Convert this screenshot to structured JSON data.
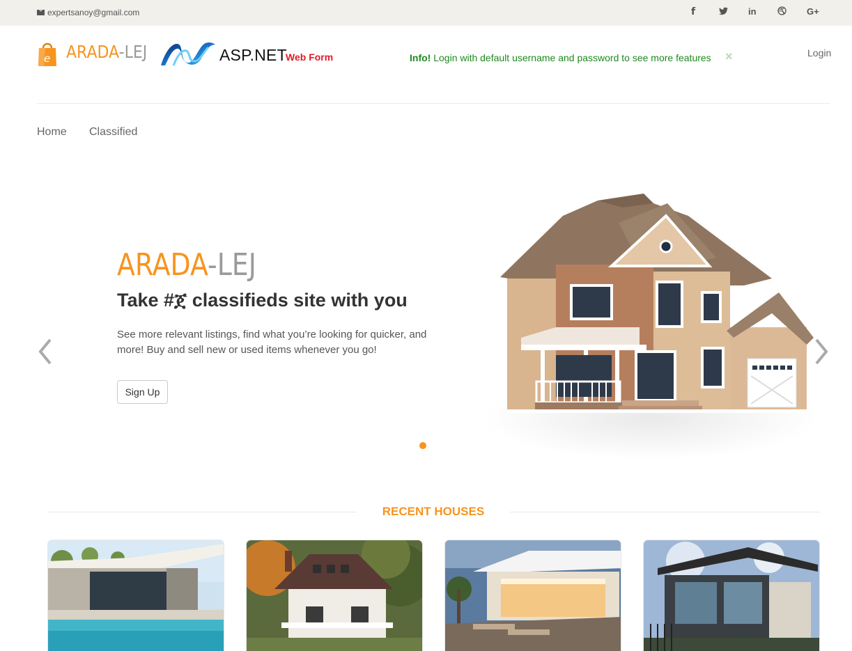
{
  "topbar": {
    "email": "expertsanoy@gmail.com",
    "social": {
      "facebook": "f",
      "twitter": "t",
      "linkedin": "in",
      "dribbble": "◎",
      "googleplus": "G+"
    }
  },
  "header": {
    "logo_orange": "ARADA",
    "logo_gray": "-LEJ",
    "asp_label": "ASP.NET",
    "asp_web": "Web Form",
    "info_bold": "Info!",
    "info_text": "Login with default username and password to see more features",
    "close": "×",
    "login": "Login"
  },
  "nav": {
    "home": "Home",
    "classified": "Classified"
  },
  "hero": {
    "title_orange": "ARADA",
    "title_gray": "-LEJ",
    "subtitle": "Take #ጀ classifieds site with you",
    "description": "See more relevant listings, find what you’re looking for quicker, and more! Buy and sell new or used items whenever you go!",
    "signup": "Sign Up"
  },
  "recent": {
    "title": "RECENT HOUSES"
  },
  "colors": {
    "accent": "#f7941d",
    "info_green": "#1f8a1f",
    "asp_red": "#e21b22",
    "topbar_bg": "#f1f0eb"
  },
  "icons": [
    "envelope-icon",
    "facebook-icon",
    "twitter-icon",
    "linkedin-icon",
    "dribbble-icon",
    "google-plus-icon",
    "chevron-left-icon",
    "chevron-right-icon"
  ]
}
